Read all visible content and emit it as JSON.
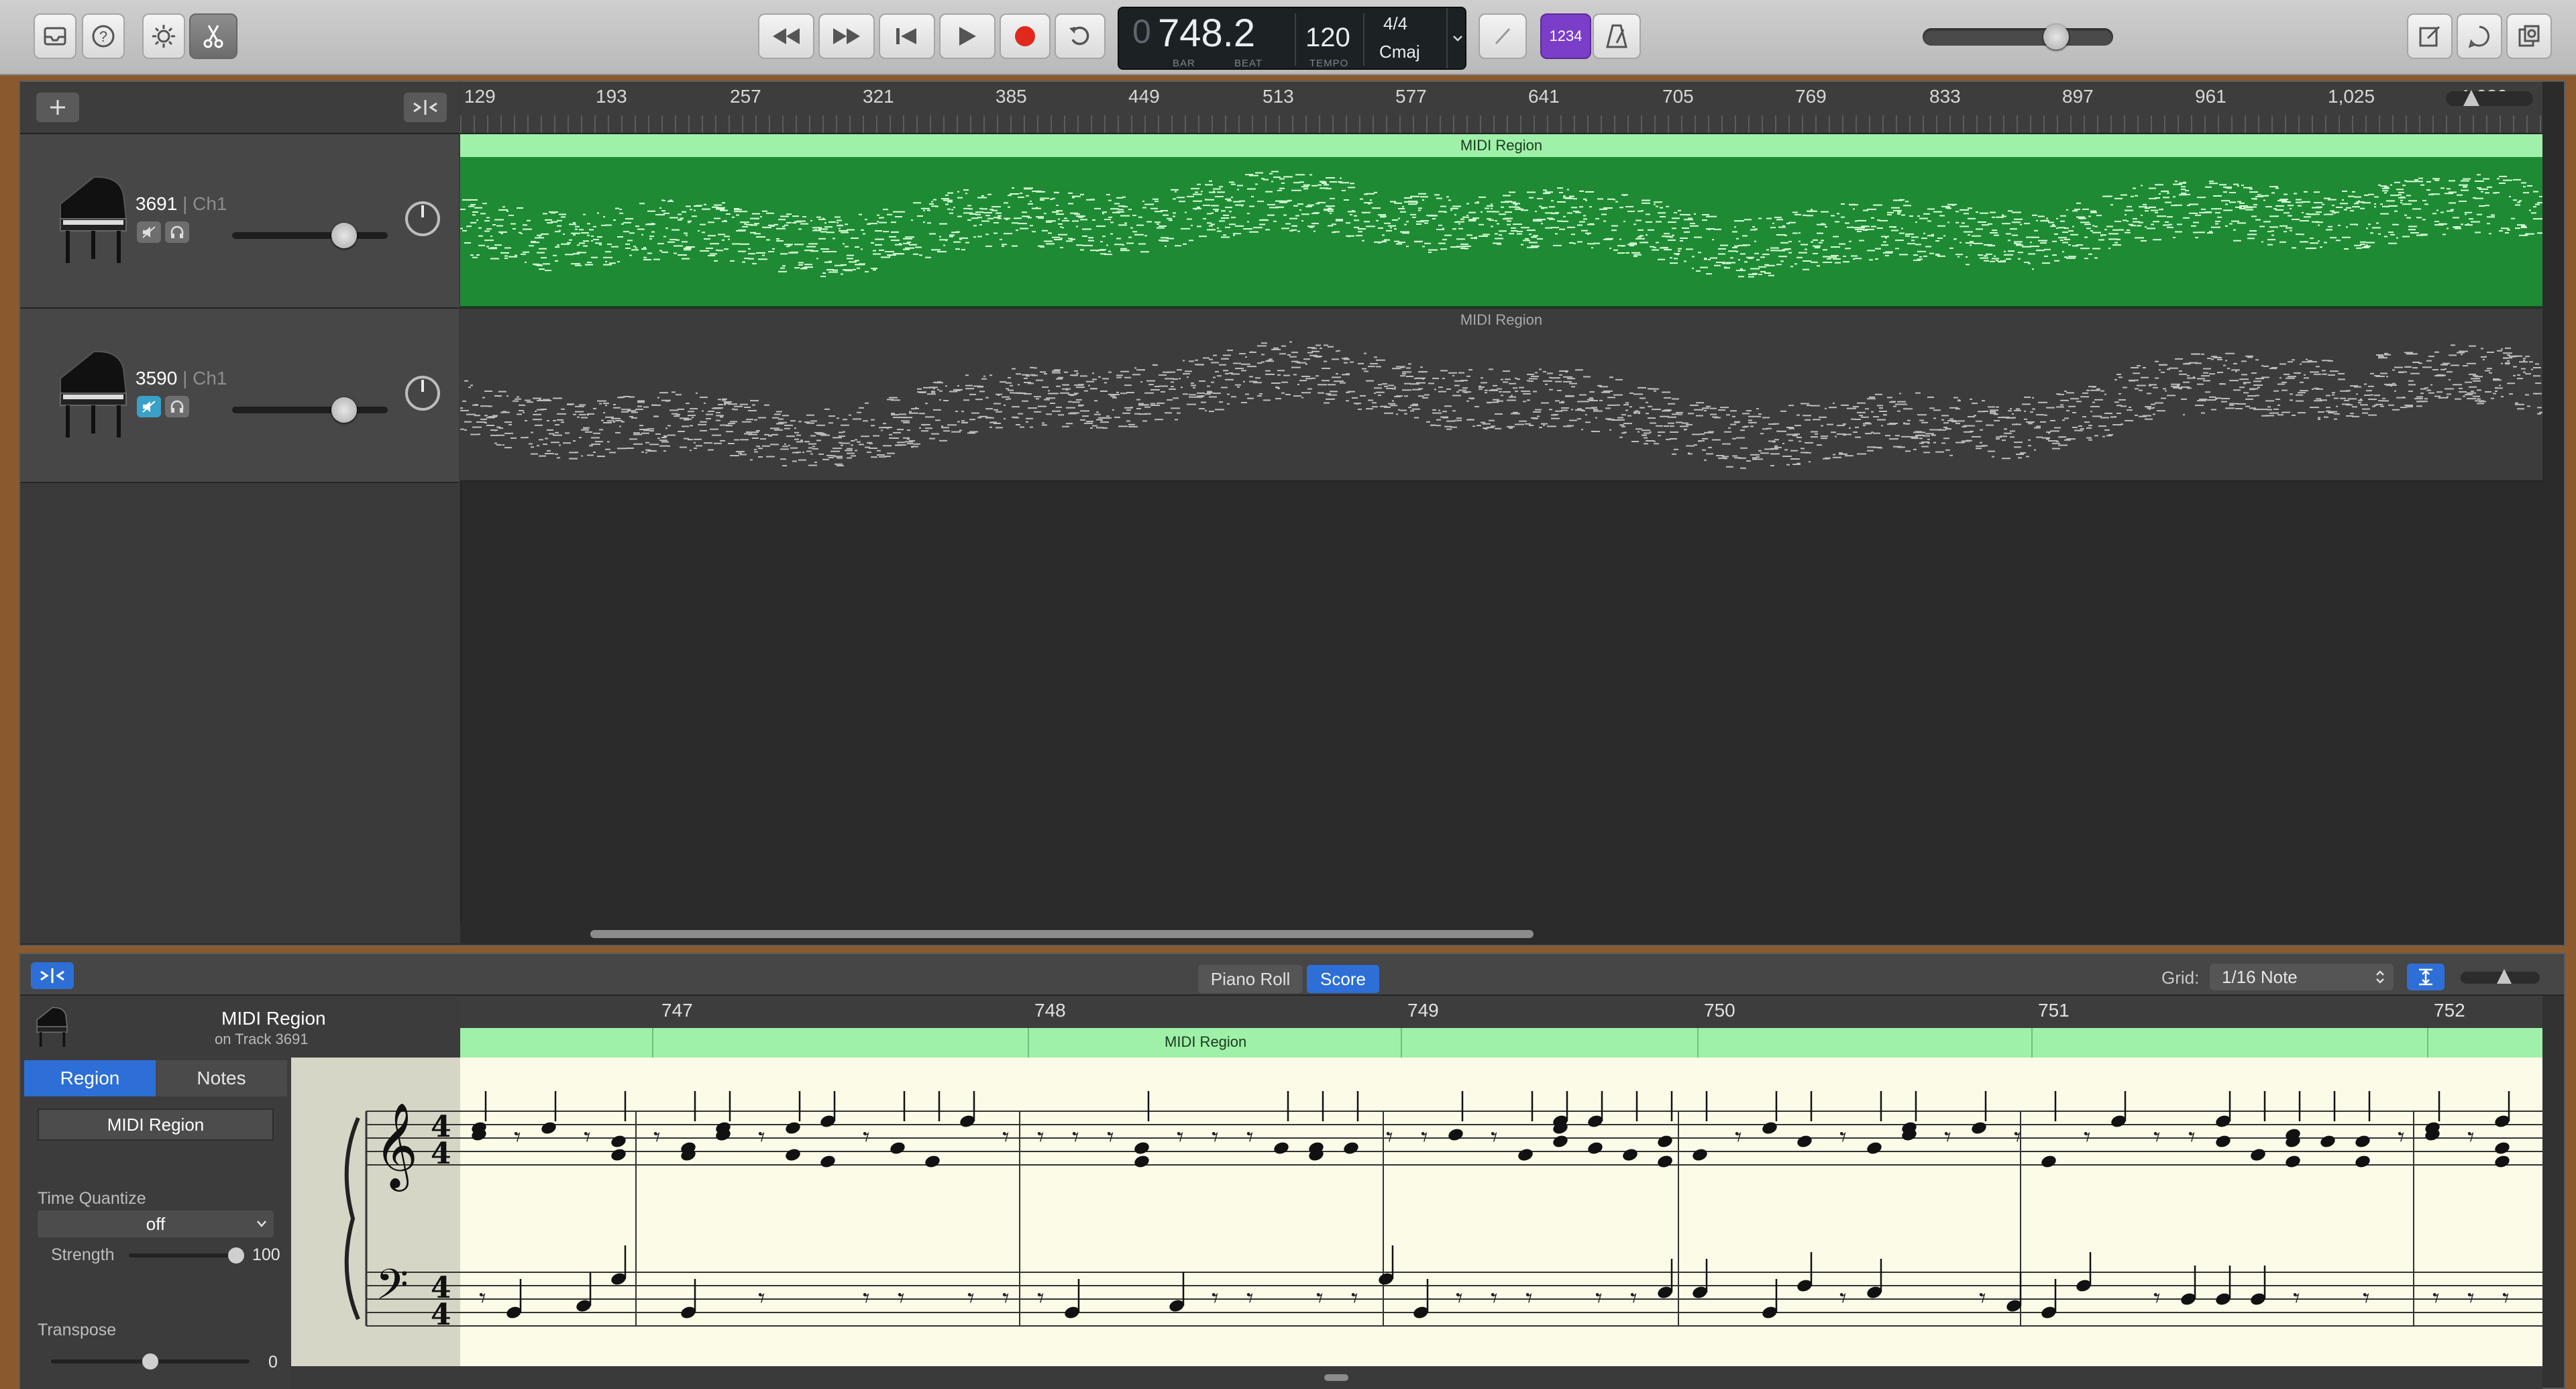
{
  "toolbar": {
    "transport_value": "748.2",
    "transport_sub_bar": "BAR",
    "transport_sub_beat": "BEAT",
    "tempo": "120",
    "tempo_label": "TEMPO",
    "signature": "4/4",
    "key": "Cmaj",
    "count_in": "1234",
    "master_volume_fraction": 0.7
  },
  "ruler": {
    "labels": [
      "129",
      "193",
      "257",
      "321",
      "385",
      "449",
      "513",
      "577",
      "641",
      "705",
      "769",
      "833",
      "897",
      "961",
      "1,025",
      "1,089"
    ]
  },
  "tracks": [
    {
      "name": "3691",
      "channel": "| Ch1",
      "region_label": "MIDI Region",
      "volume_fraction": 0.72,
      "selected": true
    },
    {
      "name": "3590",
      "channel": "| Ch1",
      "region_label": "MIDI Region",
      "volume_fraction": 0.72,
      "selected": false
    }
  ],
  "editor": {
    "tabs": [
      "Piano Roll",
      "Score"
    ],
    "active_tab": "Score",
    "grid_label": "Grid:",
    "grid_value": "1/16 Note",
    "region_name": "MIDI Region",
    "region_track": "on Track 3691",
    "inspector_tabs": [
      "Region",
      "Notes"
    ],
    "inspector_region_field": "MIDI Region",
    "time_quantize_label": "Time Quantize",
    "time_quantize_value": "off",
    "strength_label": "Strength",
    "strength_value": "100",
    "transpose_label": "Transpose",
    "transpose_value": "0",
    "measures": [
      "747",
      "748",
      "749",
      "750",
      "751",
      "752"
    ],
    "score_region_label": "MIDI Region",
    "time_signature_top": "4",
    "time_signature_bottom": "4"
  },
  "icons": [
    "inbox-icon",
    "help-icon",
    "smart-controls-icon",
    "scissors-icon",
    "rewind-icon",
    "fast-forward-icon",
    "go-to-start-icon",
    "play-icon",
    "record-icon",
    "cycle-icon",
    "tuner-icon",
    "metronome-icon",
    "notepad-icon",
    "loop-browser-icon",
    "media-browser-icon",
    "add-track-icon",
    "catch-playhead-icon",
    "piano-icon",
    "mute-icon",
    "headphones-icon"
  ],
  "colors": {
    "region_green": "#1f8a34",
    "region_green_header": "#9ff0a8",
    "score_bg": "#fbfbe8",
    "active_blue": "#2d6fd6",
    "count_in_purple": "#7b3ec8",
    "record_red": "#e0281e"
  }
}
